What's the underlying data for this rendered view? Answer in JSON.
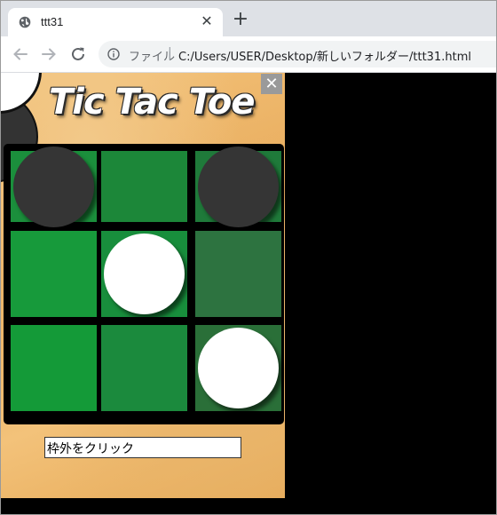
{
  "browser": {
    "tab_title": "ttt31",
    "tab_close_glyph": "✕",
    "new_tab_glyph": "+",
    "scheme_label": "ファイル",
    "separator": "|",
    "url": "C:/Users/USER/Desktop/新しいフォルダー/ttt31.html"
  },
  "game": {
    "title": "Tic Tac Toe",
    "close_glyph": "✕",
    "status_text": "枠外をクリック",
    "board": [
      [
        "dark",
        "",
        "dark"
      ],
      [
        "",
        "white",
        ""
      ],
      [
        "",
        "",
        "white"
      ]
    ],
    "cell_colors": [
      [
        "#1b8f3c",
        "#1c8739",
        "#1f7a3a"
      ],
      [
        "#179a3b",
        "#188e3c",
        "#2d7340"
      ],
      [
        "#149a38",
        "#1b8a3d",
        "#2a6f38"
      ]
    ],
    "piece_colors": {
      "white": "#ffffff",
      "dark": "#353535"
    }
  }
}
